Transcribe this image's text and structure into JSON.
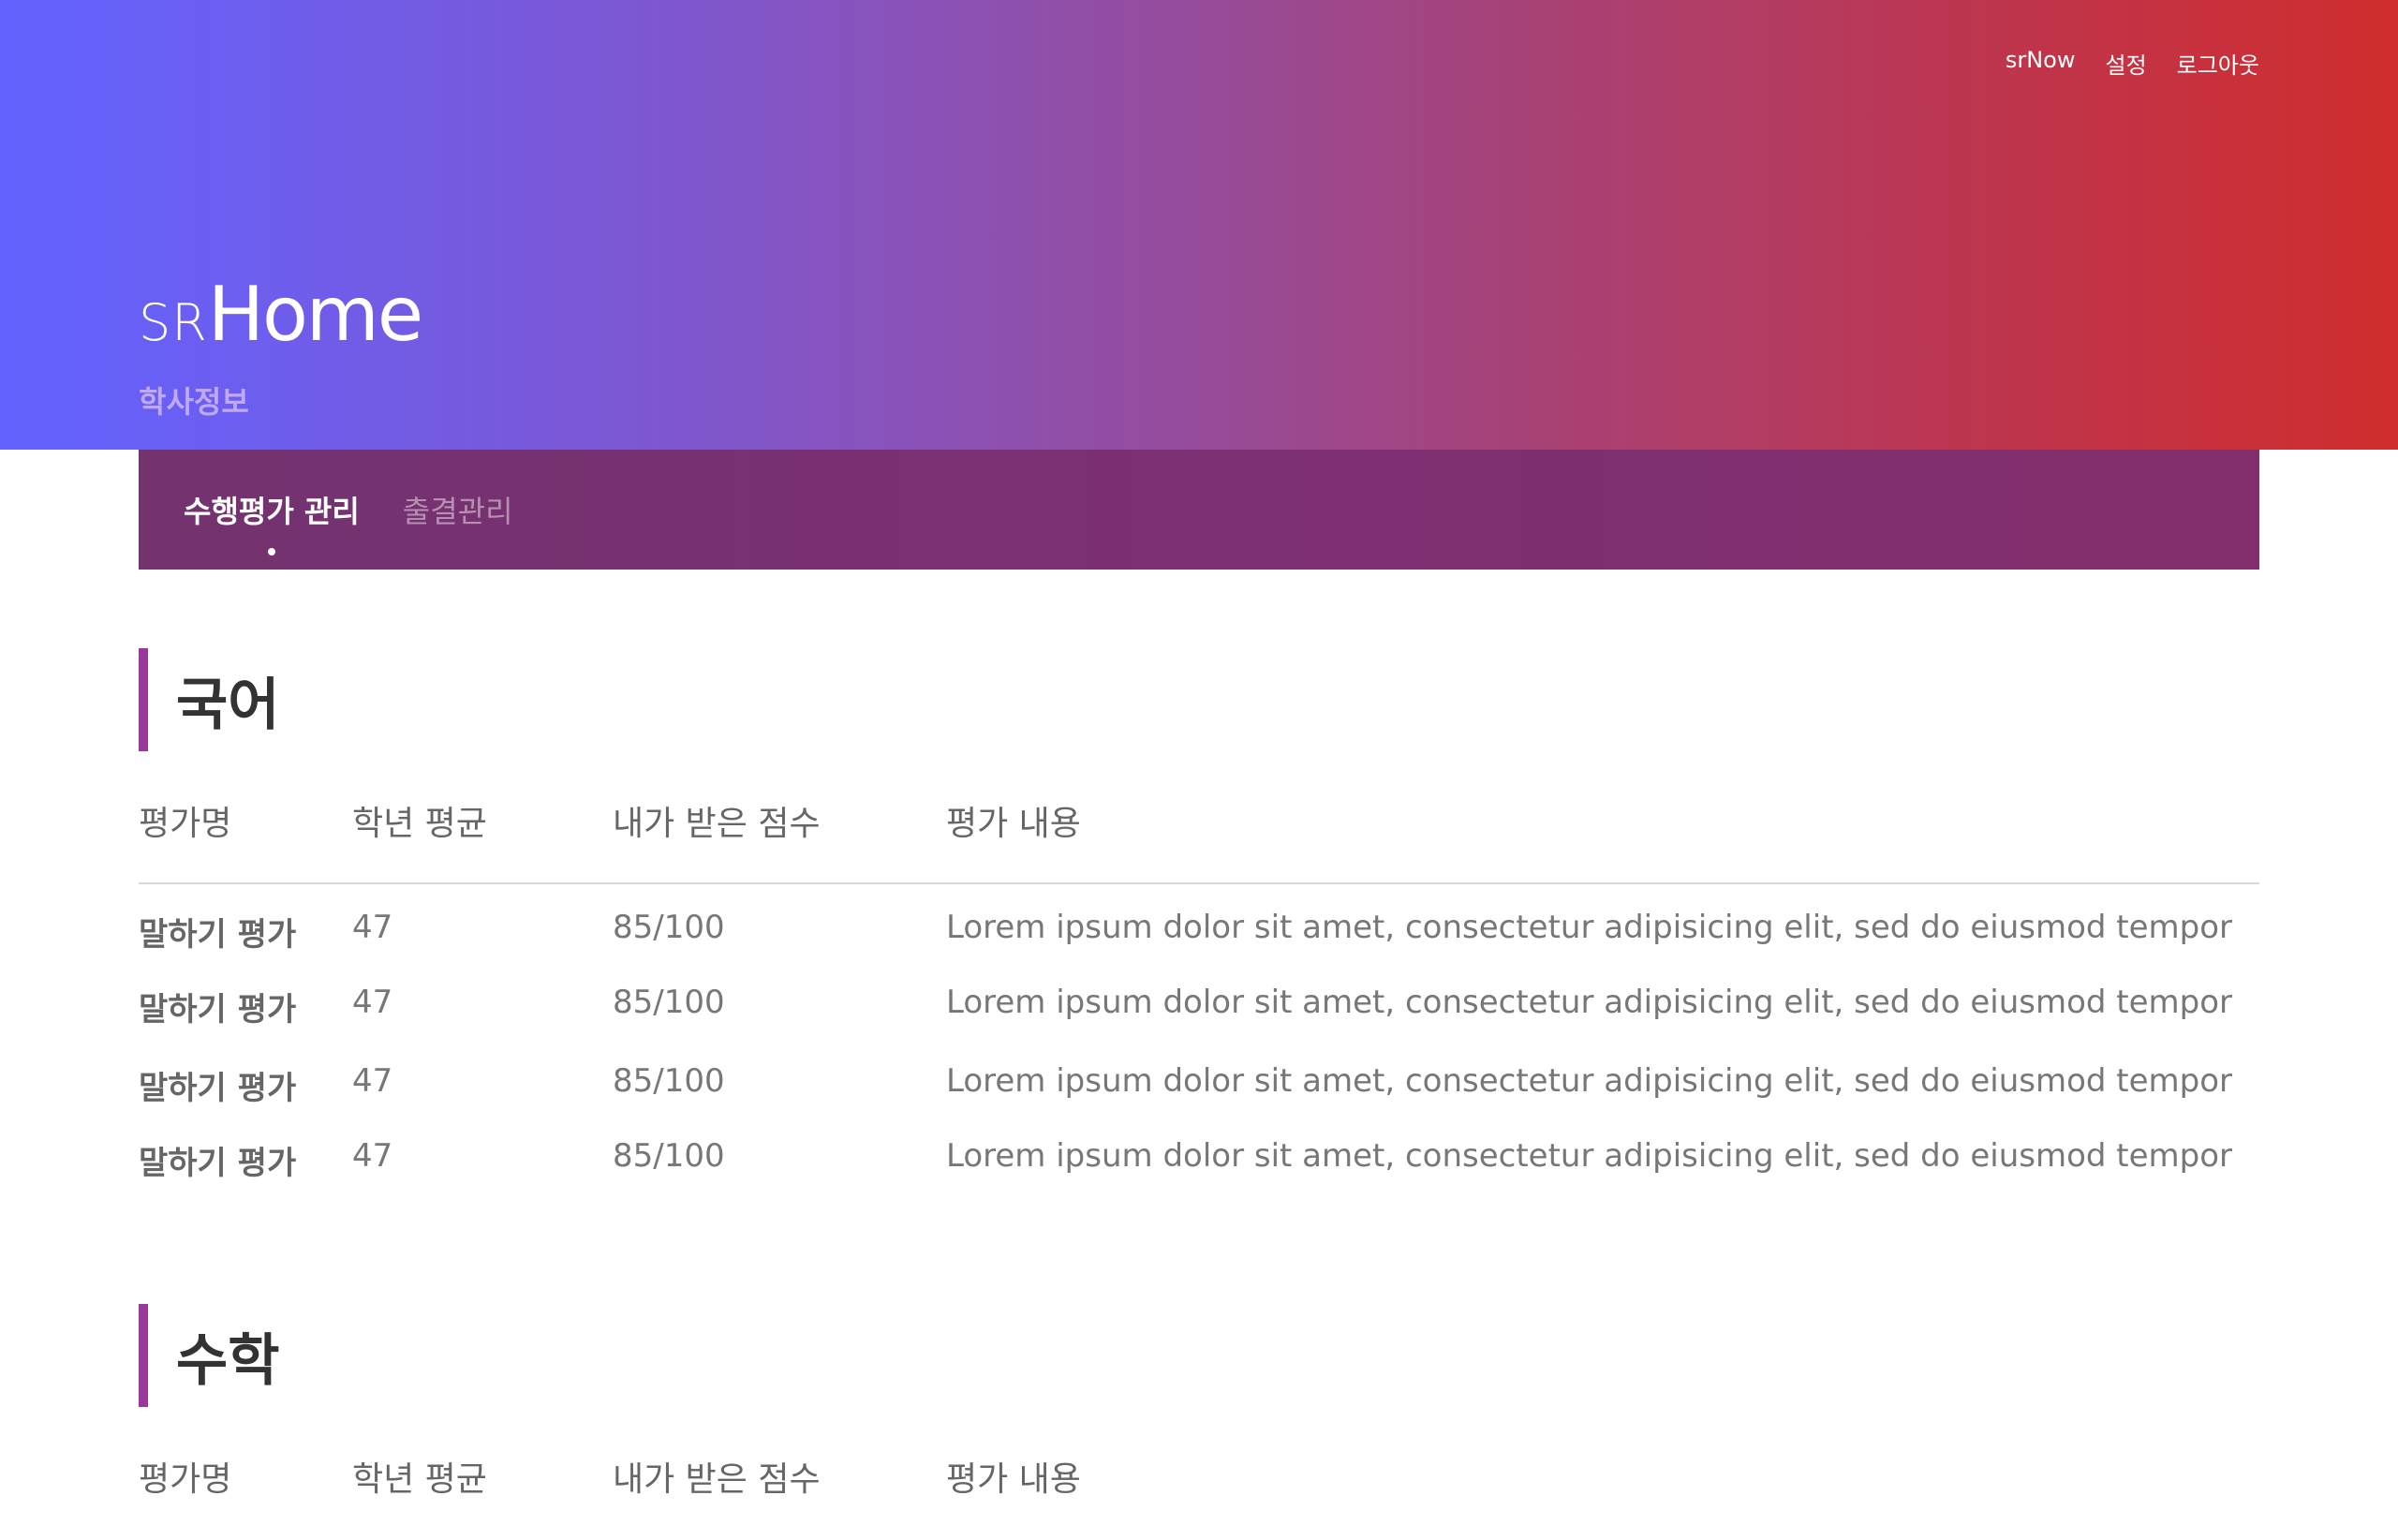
{
  "header": {
    "nav": [
      "srNow",
      "설정",
      "로그아웃"
    ],
    "brand_prefix": "SR",
    "brand_main": "Home",
    "subtitle": "학사정보"
  },
  "tabs": [
    {
      "label": "수행평가 관리",
      "active": true
    },
    {
      "label": "출결관리",
      "active": false
    }
  ],
  "sections": [
    {
      "title": "국어",
      "columns": [
        "평가명",
        "학년 평균",
        "내가 받은 점수",
        "평가 내용"
      ],
      "rows": [
        [
          "말하기 평가",
          "47",
          "85/100",
          "Lorem ipsum dolor sit amet, consectetur adipisicing elit, sed do eiusmod tempor"
        ],
        [
          "말하기 평가",
          "47",
          "85/100",
          "Lorem ipsum dolor sit amet, consectetur adipisicing elit, sed do eiusmod tempor"
        ],
        [
          "말하기 평가",
          "47",
          "85/100",
          "Lorem ipsum dolor sit amet, consectetur adipisicing elit, sed do eiusmod tempor"
        ],
        [
          "말하기 평가",
          "47",
          "85/100",
          "Lorem ipsum dolor sit amet, consectetur adipisicing elit, sed do eiusmod tempor"
        ]
      ]
    },
    {
      "title": "수학",
      "columns": [
        "평가명",
        "학년 평균",
        "내가 받은 점수",
        "평가 내용"
      ],
      "rows": []
    }
  ],
  "colors": {
    "gradient_start": "#6262ff",
    "gradient_end": "#d02d2d",
    "tabbar": "#7c2f72",
    "accent_bar": "#98399a",
    "subtitle": "#c0a9f2"
  }
}
